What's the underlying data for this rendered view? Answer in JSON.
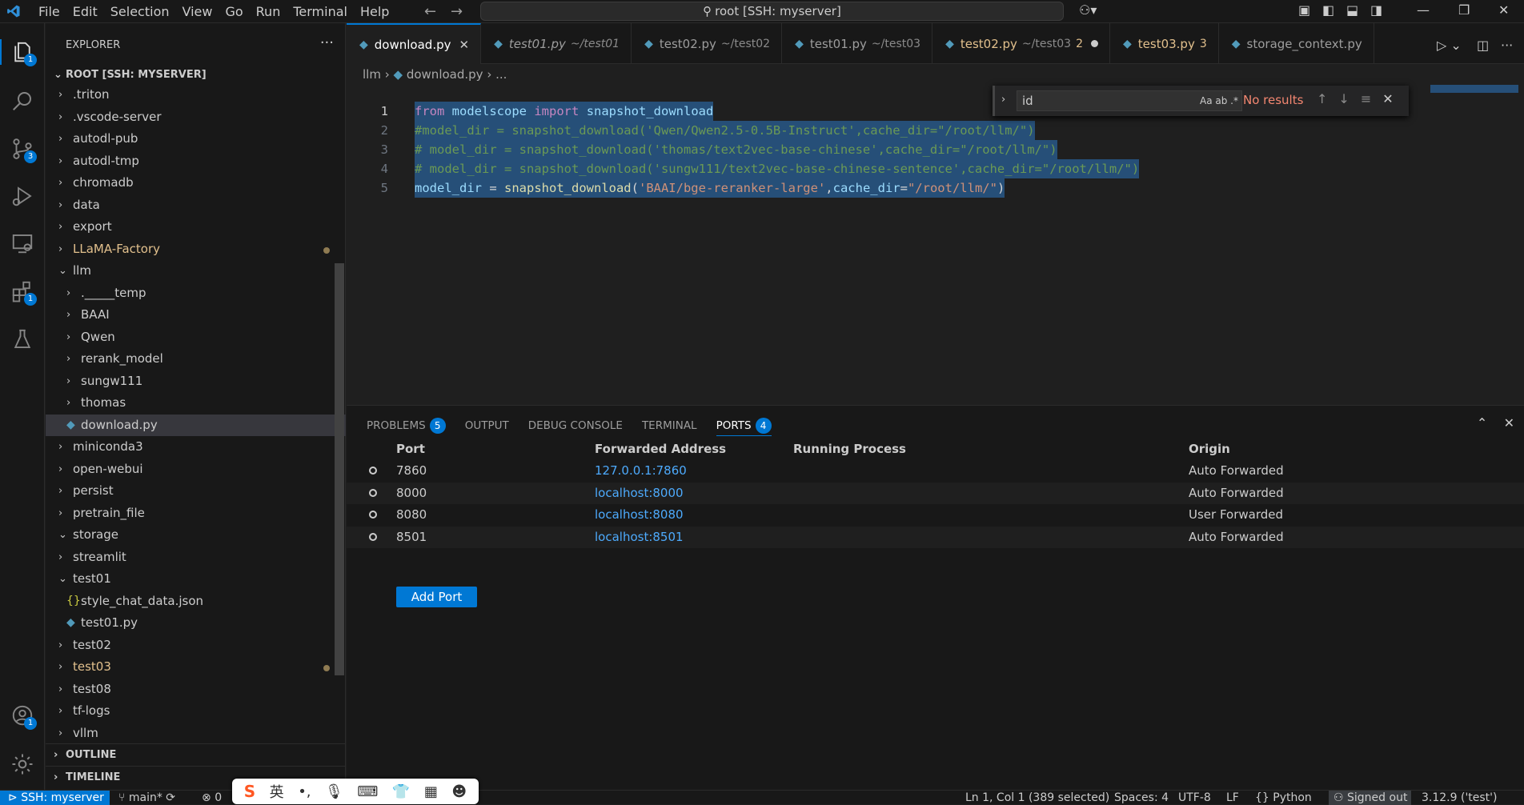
{
  "menu": [
    "File",
    "Edit",
    "Selection",
    "View",
    "Go",
    "Run",
    "Terminal",
    "Help"
  ],
  "search_box": "root [SSH: myserver]",
  "activity_badges": {
    "explorer": "1",
    "source_control": "3",
    "extensions": "1",
    "accounts": "1"
  },
  "sidebar": {
    "title": "EXPLORER",
    "root": "ROOT [SSH: MYSERVER]",
    "tree": [
      {
        "label": ".triton",
        "depth": 0,
        "open": false
      },
      {
        "label": ".vscode-server",
        "depth": 0,
        "open": false
      },
      {
        "label": "autodl-pub",
        "depth": 0,
        "open": false
      },
      {
        "label": "autodl-tmp",
        "depth": 0,
        "open": false
      },
      {
        "label": "chromadb",
        "depth": 0,
        "open": false
      },
      {
        "label": "data",
        "depth": 0,
        "open": false
      },
      {
        "label": "export",
        "depth": 0,
        "open": false
      },
      {
        "label": "LLaMA-Factory",
        "depth": 0,
        "open": false,
        "modified": true
      },
      {
        "label": "llm",
        "depth": 0,
        "open": true
      },
      {
        "label": "._____temp",
        "depth": 1,
        "open": false
      },
      {
        "label": "BAAI",
        "depth": 1,
        "open": false
      },
      {
        "label": "Qwen",
        "depth": 1,
        "open": false
      },
      {
        "label": "rerank_model",
        "depth": 1,
        "open": false
      },
      {
        "label": "sungw111",
        "depth": 1,
        "open": false
      },
      {
        "label": "thomas",
        "depth": 1,
        "open": false
      },
      {
        "label": "download.py",
        "depth": 1,
        "file": "py",
        "selected": true
      },
      {
        "label": "miniconda3",
        "depth": 0,
        "open": false
      },
      {
        "label": "open-webui",
        "depth": 0,
        "open": false
      },
      {
        "label": "persist",
        "depth": 0,
        "open": false
      },
      {
        "label": "pretrain_file",
        "depth": 0,
        "open": false
      },
      {
        "label": "storage",
        "depth": 0,
        "open": true
      },
      {
        "label": "streamlit",
        "depth": 0,
        "open": false
      },
      {
        "label": "test01",
        "depth": 0,
        "open": true
      },
      {
        "label": "style_chat_data.json",
        "depth": 1,
        "file": "json"
      },
      {
        "label": "test01.py",
        "depth": 1,
        "file": "py"
      },
      {
        "label": "test02",
        "depth": 0,
        "open": false
      },
      {
        "label": "test03",
        "depth": 0,
        "open": false,
        "modified": true
      },
      {
        "label": "test08",
        "depth": 0,
        "open": false
      },
      {
        "label": "tf-logs",
        "depth": 0,
        "open": false
      },
      {
        "label": "vllm",
        "depth": 0,
        "open": false
      }
    ],
    "outline": "OUTLINE",
    "timeline": "TIMELINE"
  },
  "tabs": [
    {
      "name": "download.py",
      "desc": "",
      "active": true
    },
    {
      "name": "test01.py",
      "desc": "~/test01",
      "italic": true
    },
    {
      "name": "test02.py",
      "desc": "~/test02"
    },
    {
      "name": "test01.py",
      "desc": "~/test03"
    },
    {
      "name": "test02.py",
      "desc": "~/test03",
      "count": "2",
      "modified": true,
      "dirty": true
    },
    {
      "name": "test03.py",
      "desc": "",
      "count": "3",
      "modified": true
    },
    {
      "name": "storage_context.py",
      "desc": ""
    }
  ],
  "breadcrumb": {
    "folder": "llm",
    "file": "download.py",
    "rest": "..."
  },
  "find": {
    "value": "id",
    "result": "No results",
    "opts": "Aa  ab  .*"
  },
  "code": [
    [
      {
        "c": "kw",
        "t": "from"
      },
      {
        "c": "pl",
        "t": " "
      },
      {
        "c": "id",
        "t": "modelscope"
      },
      {
        "c": "pl",
        "t": " "
      },
      {
        "c": "kw",
        "t": "import"
      },
      {
        "c": "pl",
        "t": " "
      },
      {
        "c": "id",
        "t": "snapshot_download"
      }
    ],
    [
      {
        "c": "cm",
        "t": "#model_dir = snapshot_download('Qwen/Qwen2.5-0.5B-Instruct',cache_dir=\"/root/llm/\")"
      }
    ],
    [
      {
        "c": "cm",
        "t": "# model_dir = snapshot_download('thomas/text2vec-base-chinese',cache_dir=\"/root/llm/\")"
      }
    ],
    [
      {
        "c": "cm",
        "t": "# model_dir = snapshot_download('sungw111/text2vec-base-chinese-sentence',cache_dir=\"/root/llm/\")"
      }
    ],
    [
      {
        "c": "id",
        "t": "model_dir"
      },
      {
        "c": "pl",
        "t": " = "
      },
      {
        "c": "fn",
        "t": "snapshot_download"
      },
      {
        "c": "pl",
        "t": "("
      },
      {
        "c": "str",
        "t": "'BAAI/bge-reranker-large'"
      },
      {
        "c": "pl",
        "t": ","
      },
      {
        "c": "id",
        "t": "cache_dir"
      },
      {
        "c": "pl",
        "t": "="
      },
      {
        "c": "str",
        "t": "\"/root/llm/\""
      },
      {
        "c": "pl",
        "t": ")"
      }
    ]
  ],
  "panel": {
    "tabs": [
      {
        "label": "PROBLEMS",
        "badge": "5"
      },
      {
        "label": "OUTPUT"
      },
      {
        "label": "DEBUG CONSOLE"
      },
      {
        "label": "TERMINAL"
      },
      {
        "label": "PORTS",
        "badge": "4",
        "active": true
      }
    ],
    "columns": [
      "Port",
      "Forwarded Address",
      "Running Process",
      "Origin"
    ],
    "rows": [
      {
        "port": "7860",
        "address": "127.0.0.1:7860",
        "process": "",
        "origin": "Auto Forwarded"
      },
      {
        "port": "8000",
        "address": "localhost:8000",
        "process": "",
        "origin": "Auto Forwarded"
      },
      {
        "port": "8080",
        "address": "localhost:8080",
        "process": "",
        "origin": "User Forwarded"
      },
      {
        "port": "8501",
        "address": "localhost:8501",
        "process": "",
        "origin": "Auto Forwarded"
      }
    ],
    "add_port": "Add Port"
  },
  "status": {
    "remote": "SSH: myserver",
    "branch": "main*",
    "errors": "0",
    "position": "Ln 1, Col 1 (389 selected)",
    "spaces": "Spaces: 4",
    "encoding": "UTF-8",
    "eol": "LF",
    "language": "Python",
    "signed": "Signed out",
    "interpreter": "3.12.9 ('test')"
  },
  "ime": {
    "brand": "S",
    "lang": "英"
  }
}
